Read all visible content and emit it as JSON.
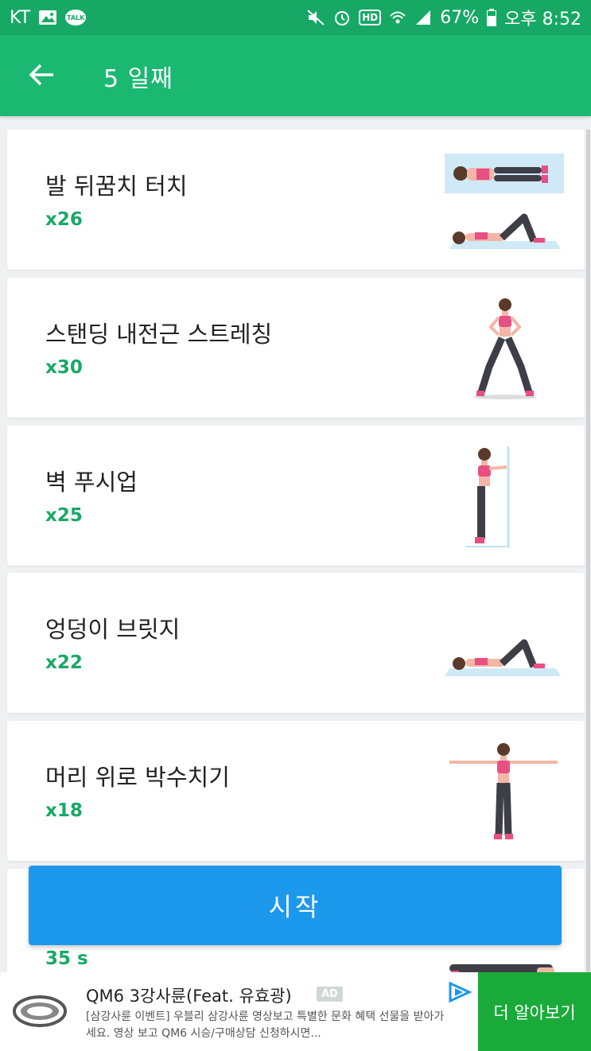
{
  "status_bar": {
    "carrier": "KT",
    "talk_label": "TALK",
    "hd_label": "HD",
    "battery": "67%",
    "time": "오후 8:52"
  },
  "app_bar": {
    "title": "5 일째"
  },
  "exercises": [
    {
      "name": "발 뒤꿈치 터치",
      "reps": "x26",
      "icon": "heel-touch-illustration"
    },
    {
      "name": "스탠딩 내전근 스트레칭",
      "reps": "x30",
      "icon": "standing-adductor-stretch-illustration"
    },
    {
      "name": "벽 푸시업",
      "reps": "x25",
      "icon": "wall-pushup-illustration"
    },
    {
      "name": "엉덩이 브릿지",
      "reps": "x22",
      "icon": "glute-bridge-illustration"
    },
    {
      "name": "머리 위로 박수치기",
      "reps": "x18",
      "icon": "overhead-clap-illustration"
    },
    {
      "name": "",
      "reps": "35 s",
      "icon": "plank-illustration"
    }
  ],
  "start_button": {
    "label": "시작"
  },
  "ad": {
    "title": "QM6 3강사륜(Feat. 유효광)",
    "badge": "AD",
    "description": "[삼강사륜 이벤트] 우블리 삼강사륜 영상보고 특별한 문화 혜택 선물을 받아가세요. 영상 보고 QM6 시승/구매상담 신청하시면...",
    "cta": "더 알아보기"
  },
  "colors": {
    "status_bar": "#17a866",
    "app_bar": "#1bb872",
    "reps": "#1aa866",
    "start_button": "#1c98ec",
    "ad_cta": "#1aaa3a"
  }
}
